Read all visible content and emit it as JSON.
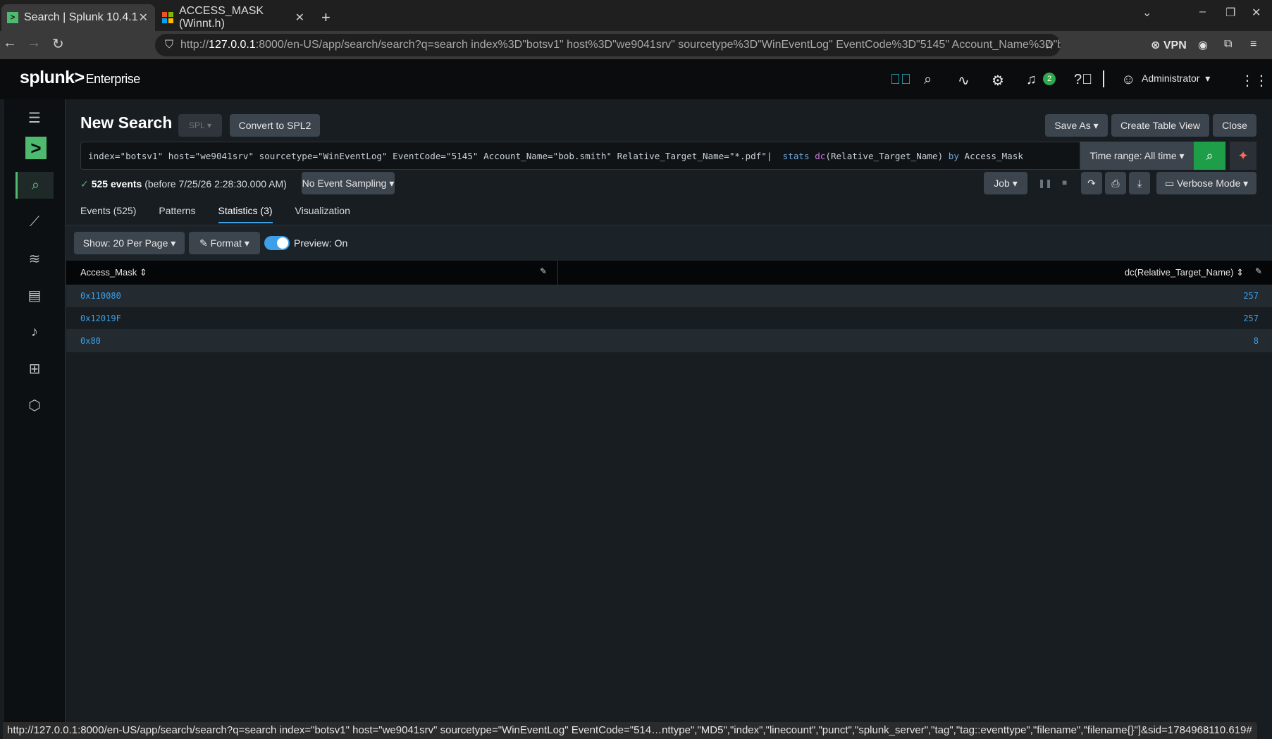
{
  "browser": {
    "tabs": [
      {
        "title": "Search | Splunk 10.4.1",
        "active": true
      },
      {
        "title": "ACCESS_MASK (Winnt.h)",
        "active": false
      }
    ],
    "url_prefix": "http://",
    "url_host": "127.0.0.1",
    "url_rest": ":8000/en-US/app/search/search?q=search index%3D\"botsv1\" host%3D\"we9041srv\" sourcetype%3D\"WinEventLog\" EventCode%3D\"5145\" Account_Name%3D\"bo",
    "vpn_label": "VPN",
    "status_url": "http://127.0.0.1:8000/en-US/app/search/search?q=search index=\"botsv1\" host=\"we9041srv\" sourcetype=\"WinEventLog\" EventCode=\"514…nttype\",\"MD5\",\"index\",\"linecount\",\"punct\",\"splunk_server\",\"tag\",\"tag::eventtype\",\"filename\",\"filename{}\"]&sid=1784968110.619#"
  },
  "splunk": {
    "brand": "splunk>",
    "product": "Enterprise",
    "notifications_count": "2",
    "user": "Administrator",
    "page_title": "New Search",
    "spl_label": "SPL",
    "convert_label": "Convert to SPL2",
    "save_as_label": "Save As",
    "create_table_label": "Create Table View",
    "close_label": "Close",
    "query": {
      "part1": "index=\"botsv1\" host=\"we9041srv\" sourcetype=\"WinEventLog\" EventCode=\"5145\" Account_Name=\"bob.smith\" Relative_Target_Name=\"*.pdf\"|  ",
      "kw_stats": "stats",
      "fn_dc": "dc",
      "part2": "(Relative_Target_Name) ",
      "kw_by": "by",
      "part3": " Access_Mask"
    },
    "time_range_label": "Time range: All time",
    "status_count": "525 events",
    "status_rest": "(before 7/25/26 2:28:30.000 AM)",
    "sampling_label": "No Event Sampling",
    "job_label": "Job",
    "mode_label": "Verbose Mode",
    "tabs": [
      "Events (525)",
      "Patterns",
      "Statistics (3)",
      "Visualization"
    ],
    "show_label": "Show: 20 Per Page",
    "format_label": "Format",
    "preview_label": "Preview: On",
    "table": {
      "columns": [
        "Access_Mask",
        "dc(Relative_Target_Name)"
      ],
      "rows": [
        [
          "0x110080",
          "257"
        ],
        [
          "0x12019F",
          "257"
        ],
        [
          "0x80",
          "8"
        ]
      ]
    }
  }
}
